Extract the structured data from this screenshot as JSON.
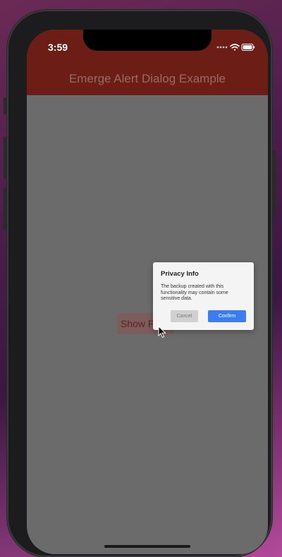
{
  "status_bar": {
    "time": "3:59"
  },
  "app_bar": {
    "title": "Emerge Alert Dialog Example"
  },
  "main": {
    "show_button_label": "Show Pr"
  },
  "dialog": {
    "title": "Privacy Info",
    "body": "The backup created with this functionality may contain some sensitive data.",
    "cancel_label": "Cancel",
    "confirm_label": "Confirm"
  },
  "colors": {
    "app_bar": "#6b1d16",
    "confirm_button": "#3b7df0",
    "scrim": "#6b6b6b"
  },
  "icons": [
    "signal-dots-icon",
    "wifi-icon",
    "battery-icon",
    "mouse-pointer-icon"
  ]
}
